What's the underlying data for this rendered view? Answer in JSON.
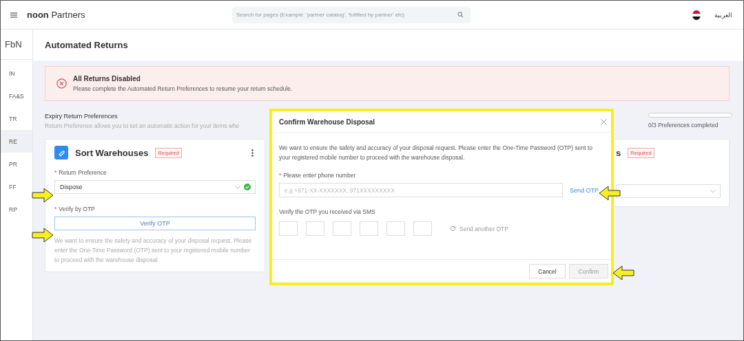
{
  "header": {
    "brand_bold": "noon",
    "brand": "Partners",
    "search": {
      "placeholder": "Search for pages (Example: 'partner catalog', 'fulfilled by partner' etc)"
    },
    "language": "العربية"
  },
  "sidebar": {
    "title": "FbN",
    "items": [
      {
        "label": "IN",
        "selected": false
      },
      {
        "label": "FA&S",
        "selected": false
      },
      {
        "label": "TR",
        "selected": false
      },
      {
        "label": "RE",
        "selected": true
      },
      {
        "label": "PR",
        "selected": false
      },
      {
        "label": "FF",
        "selected": false
      },
      {
        "label": "RP",
        "selected": false
      }
    ]
  },
  "page": {
    "title": "Automated Returns"
  },
  "alert": {
    "title": "All Returns Disabled",
    "message": "Please complete the Automated Return Preferences to resume your return schedule."
  },
  "preferences": {
    "title": "Expiry Return Preferences",
    "description": "Return Preference allows you to set an automatic action for your items whe",
    "progress": {
      "level": 0,
      "label": "0/3 Preferences completed"
    }
  },
  "cards": [
    {
      "title": "Sort Warehouses",
      "badge": "Required",
      "preference": {
        "label": "Return Preference",
        "required_mark": "*",
        "value": "Dispose",
        "valid": true
      },
      "otp": {
        "label": "Verify by OTP",
        "required_mark": "*",
        "button": "Verify OTP",
        "note": "We want to ensure the safety and accuracy of your disposal request. Please enter the One-Time Password (OTP) sent to your registered mobile number to proceed with the warehouse disposal."
      }
    },
    {
      "title": "s",
      "badge": "Required"
    }
  ],
  "modal": {
    "title": "Confirm Warehouse Disposal",
    "intro": "We want to ensure the safety and accuracy of your disposal request. Please enter the One-Time Password (OTP) sent to your registered mobile number to proceed with the warehouse disposal.",
    "phone": {
      "label": "Please enter phone number",
      "required_mark": "*",
      "placeholder": "e.g +971-XX-XXXXXXX, 971XXXXXXXXX"
    },
    "send_otp": "Send OTP",
    "otp_label": "Verify the OTP you received via SMS",
    "resend": {
      "label": "Send another OTP",
      "disabled": true
    },
    "buttons": [
      {
        "label": "Cancel",
        "disabled": false
      },
      {
        "label": "Confirm",
        "disabled": true
      }
    ]
  }
}
